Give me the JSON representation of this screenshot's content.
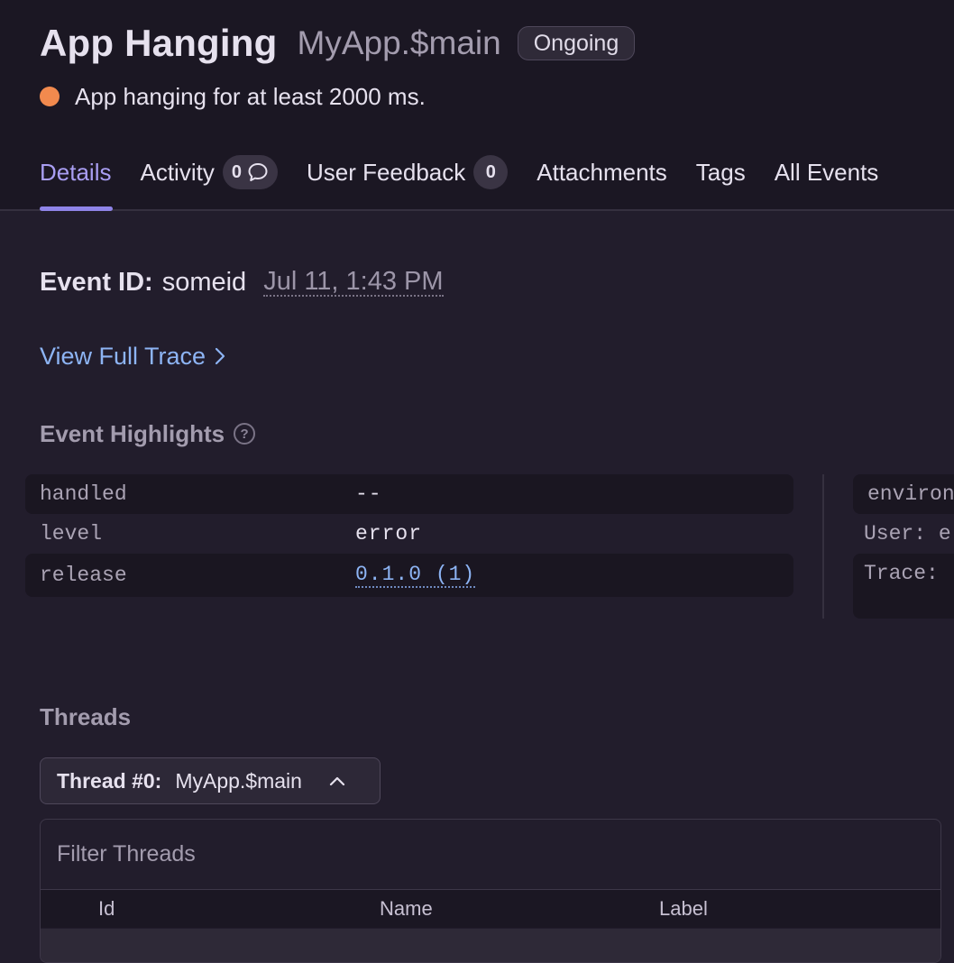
{
  "header": {
    "title": "App Hanging",
    "subtitle": "MyApp.$main",
    "status_badge": "Ongoing",
    "message": "App hanging for at least 2000 ms.",
    "status_dot_color": "#f28a4e"
  },
  "tabs": [
    {
      "label": "Details",
      "active": true
    },
    {
      "label": "Activity",
      "count": "0",
      "icon": "comment-icon"
    },
    {
      "label": "User Feedback",
      "count": "0"
    },
    {
      "label": "Attachments"
    },
    {
      "label": "Tags"
    },
    {
      "label": "All Events"
    }
  ],
  "event": {
    "id_label": "Event ID:",
    "id_value": "someid",
    "timestamp": "Jul 11, 1:43 PM",
    "trace_link": "View Full Trace"
  },
  "highlights": {
    "title": "Event Highlights",
    "rows": [
      {
        "key": "handled",
        "value": "--"
      },
      {
        "key": "level",
        "value": "error"
      },
      {
        "key": "release",
        "value": "0.1.0 (1)"
      }
    ],
    "right_rows": [
      "environ",
      "User: e",
      "Trace: "
    ]
  },
  "threads": {
    "title": "Threads",
    "selector_label": "Thread #0:",
    "selector_value": "MyApp.$main",
    "filter_placeholder": "Filter Threads",
    "columns": [
      "Id",
      "Name",
      "Label"
    ]
  },
  "colors": {
    "accent": "#8f84e8",
    "link": "#8db4f4",
    "background": "#221d2c"
  }
}
